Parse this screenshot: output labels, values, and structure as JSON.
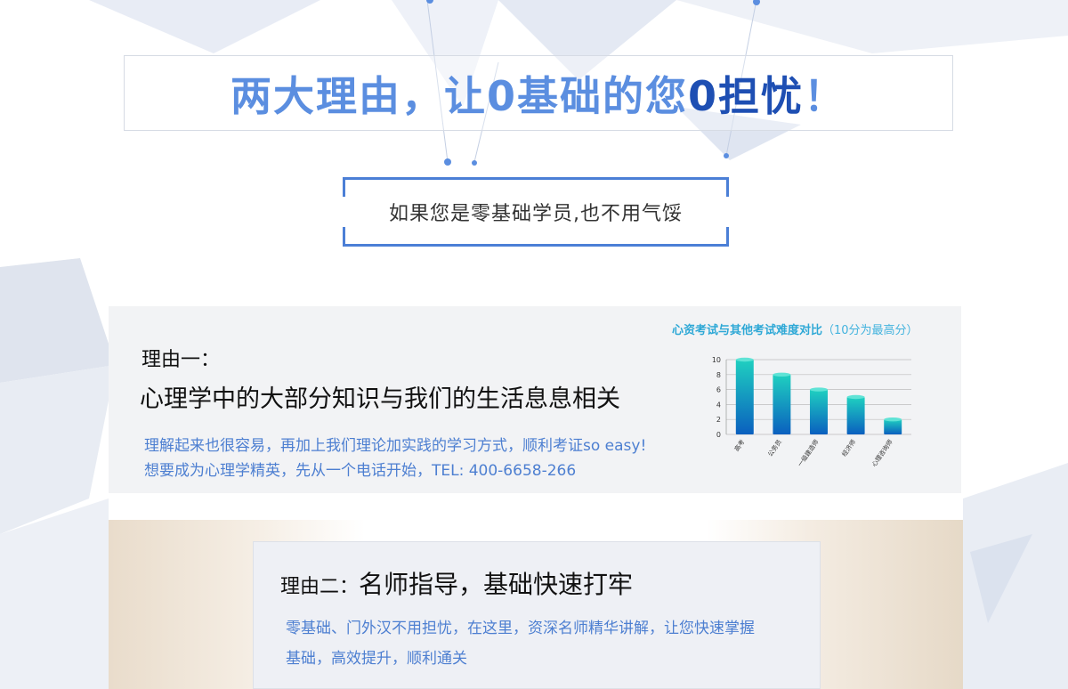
{
  "headline": {
    "text": "两大理由，让0基础的您",
    "strong": "0担忧",
    "end": "！"
  },
  "subheading": "如果您是零基础学员,也不用气馁",
  "reason1": {
    "label": "理由一：",
    "title": "心理学中的大部分知识与我们的生活息息相关",
    "line1": "理解起来也很容易，再加上我们理论加实践的学习方式，顺利考证so easy!",
    "line2": "想要成为心理学精英，先从一个电话开始，TEL: 400-6658-266"
  },
  "chart_data": {
    "type": "bar",
    "title": "心资考试与其他考试难度对比",
    "note": "（10分为最高分）",
    "categories": [
      "高考",
      "公务员",
      "一级建造师",
      "经济师",
      "心理咨询师"
    ],
    "values": [
      10,
      8,
      6,
      5,
      2
    ],
    "ylim": [
      0,
      10
    ],
    "yticks": [
      0,
      2,
      4,
      6,
      8,
      10
    ],
    "grid": true,
    "colors": {
      "bar_top": "#1fd0c0",
      "bar_bottom": "#0a5fbf",
      "grid": "#bdbdbd"
    }
  },
  "reason2": {
    "label": "理由二：",
    "title": "名师指导，基础快速打牢",
    "line1": "零基础、门外汉不用担忧，在这里，资深名师精华讲解，让您快速掌握",
    "line2": "基础，高效提升，顺利通关"
  },
  "colors": {
    "accent": "#4b7fd6",
    "headline": "#5b8ee0",
    "headline_strong": "#1e4fb3"
  }
}
